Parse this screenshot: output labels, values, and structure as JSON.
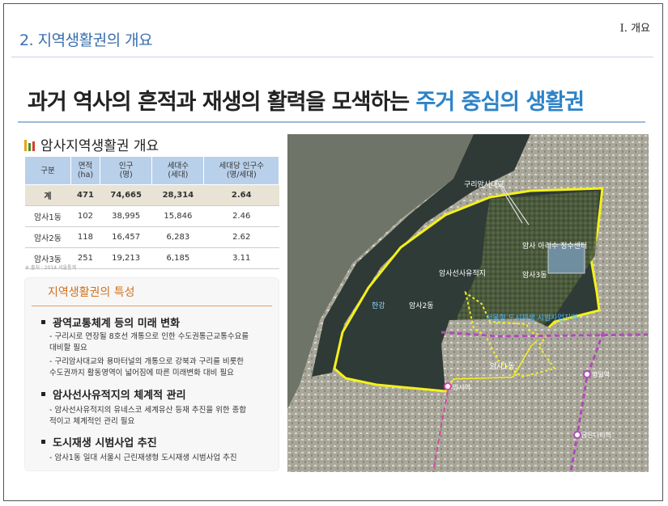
{
  "header": {
    "section_title": "2. 지역생활권의 개요",
    "chapter": "Ⅰ. 개요"
  },
  "headline": {
    "main": "과거 역사의 흔적과 재생의 활력을 모색하는 ",
    "accent": "주거 중심의 생활권"
  },
  "overview": {
    "title": "암사지역생활권 개요",
    "columns": [
      "구분",
      "면적\n(ha)",
      "인구\n(명)",
      "세대수\n(세대)",
      "세대당 인구수\n(명/세대)"
    ],
    "rows": [
      [
        "계",
        "471",
        "74,665",
        "28,314",
        "2.64"
      ],
      [
        "암사1동",
        "102",
        "38,995",
        "15,846",
        "2.46"
      ],
      [
        "암사2동",
        "118",
        "16,457",
        "6,283",
        "2.62"
      ],
      [
        "암사3동",
        "251",
        "19,213",
        "6,185",
        "3.11"
      ]
    ],
    "source": "※ 출처 : 2014 서울통계"
  },
  "features": {
    "title": "지역생활권의 특성",
    "items": [
      {
        "heading": "광역교통체계 등의 미래 변화",
        "details": [
          "- 구리시로 연장될 8호선 개통으로 인한 수도권통근교통수요를",
          "  대비할 필요",
          "- 구리암사대교와 용마터널의 개통으로 강북과 구리를 비롯한",
          "  수도권까지 활동영역이 넓어짐에 따른 미래변화 대비 필요"
        ]
      },
      {
        "heading": "암사선사유적지의 체계적 관리",
        "details": [
          "- 암사선사유적지의 유네스코 세계유산 등재 추진을 위한 종합",
          "  적이고 체계적인 관리 필요"
        ]
      },
      {
        "heading": "도시재생 시범사업 추진",
        "details": [
          "- 암사1동 일대 서울시 근린재생형 도시재생 시범사업 추진"
        ]
      }
    ]
  },
  "map": {
    "labels": {
      "bridge": "구리암사대교",
      "youth": "암사 아리수 정수센터",
      "dong3": "암사3동",
      "prehistoric": "암사선사유적지",
      "river": "한강",
      "dong2": "암사2동",
      "regen": "서울형 도시재생 시범사업지역",
      "dong1": "암사1동",
      "station_amsa": "암사역",
      "station_myeongil": "명일역",
      "station_guri": "굽은다리역"
    },
    "colors": {
      "boundary": "#f4f01a",
      "subway": "#b04bb8",
      "label": "#ffffff",
      "regen_label": "#4ab4ff"
    }
  }
}
